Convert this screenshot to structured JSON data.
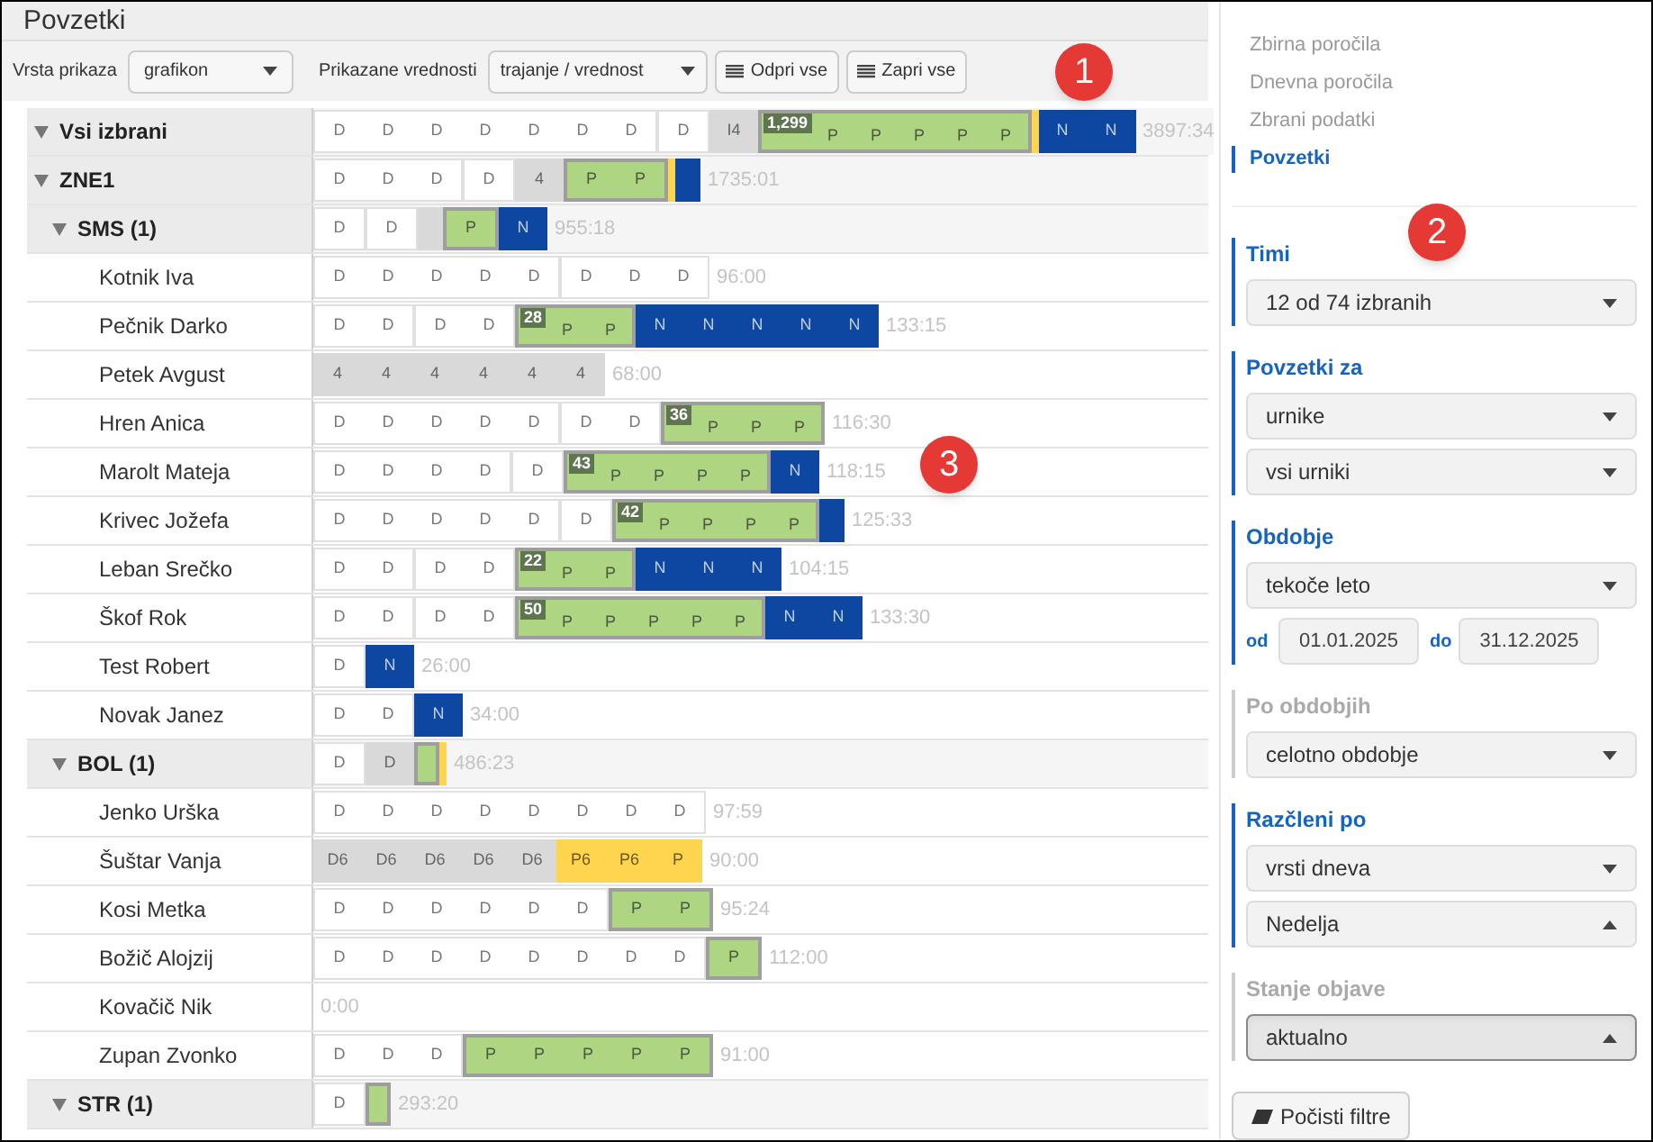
{
  "title": "Povzetki",
  "toolbar": {
    "display_type": {
      "label": "Vrsta prikaza",
      "value": "grafikon"
    },
    "shown_values": {
      "label": "Prikazane vrednosti",
      "value": "trajanje / vrednost"
    },
    "buttons": [
      "Odpri vse",
      "Zapri vse"
    ]
  },
  "tree": [
    {
      "label": "Vsi izbrani",
      "kind": "group",
      "expanded": true,
      "total": "3897:34",
      "blocks": [
        {
          "kind": "white",
          "cells": [
            "D",
            "D",
            "D",
            "D",
            "D",
            "D",
            "D"
          ]
        },
        {
          "kind": "white",
          "cells": [
            "D"
          ]
        },
        {
          "kind": "gray",
          "cells": [
            "I4"
          ]
        },
        {
          "kind": "green",
          "badge": "1,299",
          "cells": [
            "P",
            "P",
            "P",
            "P",
            "P"
          ]
        },
        {
          "kind": "stripe"
        },
        {
          "kind": "blue",
          "cells": [
            "N",
            "N"
          ]
        }
      ],
      "children": [
        {
          "label": "ZNE1",
          "kind": "group",
          "expanded": true,
          "total": "1735:01",
          "blocks": [
            {
              "kind": "white",
              "cells": [
                "D",
                "D",
                "D"
              ]
            },
            {
              "kind": "white",
              "cells": [
                "D"
              ]
            },
            {
              "kind": "gray",
              "cells": [
                "4"
              ]
            },
            {
              "kind": "green",
              "cells": [
                "P",
                "P"
              ]
            },
            {
              "kind": "stripe"
            },
            {
              "kind": "blue"
            }
          ],
          "children": [
            {
              "label": "SMS (1)",
              "kind": "subgroup",
              "expanded": true,
              "total": "955:18",
              "blocks": [
                {
                  "kind": "white",
                  "cells": [
                    "D"
                  ]
                },
                {
                  "kind": "white",
                  "cells": [
                    "D"
                  ]
                },
                {
                  "kind": "gray"
                },
                {
                  "kind": "green",
                  "cells": [
                    "P"
                  ]
                },
                {
                  "kind": "blue",
                  "cells": [
                    "N"
                  ]
                }
              ],
              "children": [
                {
                  "label": "Kotnik Iva",
                  "kind": "person",
                  "total": "96:00",
                  "blocks": [
                    {
                      "kind": "white",
                      "cells": [
                        "D",
                        "D",
                        "D",
                        "D",
                        "D"
                      ]
                    },
                    {
                      "kind": "white",
                      "cells": [
                        "D",
                        "D",
                        "D"
                      ]
                    }
                  ]
                },
                {
                  "label": "Pečnik Darko",
                  "kind": "person",
                  "total": "133:15",
                  "blocks": [
                    {
                      "kind": "white",
                      "cells": [
                        "D",
                        "D"
                      ]
                    },
                    {
                      "kind": "white",
                      "cells": [
                        "D",
                        "D"
                      ]
                    },
                    {
                      "kind": "green",
                      "badge": "28",
                      "cells": [
                        "P",
                        "P"
                      ]
                    },
                    {
                      "kind": "blue",
                      "cells": [
                        "N",
                        "N",
                        "N",
                        "N",
                        "N"
                      ]
                    }
                  ]
                },
                {
                  "label": "Petek Avgust",
                  "kind": "person",
                  "total": "68:00",
                  "blocks": [
                    {
                      "kind": "gray",
                      "cells": [
                        "4",
                        "4",
                        "4",
                        "4",
                        "4",
                        "4"
                      ]
                    }
                  ]
                },
                {
                  "label": "Hren Anica",
                  "kind": "person",
                  "total": "116:30",
                  "blocks": [
                    {
                      "kind": "white",
                      "cells": [
                        "D",
                        "D",
                        "D",
                        "D",
                        "D"
                      ]
                    },
                    {
                      "kind": "white",
                      "cells": [
                        "D",
                        "D"
                      ]
                    },
                    {
                      "kind": "green",
                      "badge": "36",
                      "cells": [
                        "P",
                        "P",
                        "P"
                      ]
                    }
                  ]
                },
                {
                  "label": "Marolt Mateja",
                  "kind": "person",
                  "total": "118:15",
                  "blocks": [
                    {
                      "kind": "white",
                      "cells": [
                        "D",
                        "D",
                        "D",
                        "D"
                      ]
                    },
                    {
                      "kind": "white",
                      "cells": [
                        "D"
                      ]
                    },
                    {
                      "kind": "green",
                      "badge": "43",
                      "cells": [
                        "P",
                        "P",
                        "P",
                        "P"
                      ]
                    },
                    {
                      "kind": "blue",
                      "cells": [
                        "N"
                      ]
                    }
                  ]
                },
                {
                  "label": "Krivec Jožefa",
                  "kind": "person",
                  "total": "125:33",
                  "blocks": [
                    {
                      "kind": "white",
                      "cells": [
                        "D",
                        "D",
                        "D",
                        "D",
                        "D"
                      ]
                    },
                    {
                      "kind": "white",
                      "cells": [
                        "D"
                      ]
                    },
                    {
                      "kind": "green",
                      "badge": "42",
                      "cells": [
                        "P",
                        "P",
                        "P",
                        "P"
                      ]
                    },
                    {
                      "kind": "blue"
                    }
                  ]
                },
                {
                  "label": "Leban Srečko",
                  "kind": "person",
                  "total": "104:15",
                  "blocks": [
                    {
                      "kind": "white",
                      "cells": [
                        "D",
                        "D"
                      ]
                    },
                    {
                      "kind": "white",
                      "cells": [
                        "D",
                        "D"
                      ]
                    },
                    {
                      "kind": "green",
                      "badge": "22",
                      "cells": [
                        "P",
                        "P"
                      ]
                    },
                    {
                      "kind": "blue",
                      "cells": [
                        "N",
                        "N",
                        "N"
                      ]
                    }
                  ]
                },
                {
                  "label": "Škof Rok",
                  "kind": "person",
                  "total": "133:30",
                  "blocks": [
                    {
                      "kind": "white",
                      "cells": [
                        "D",
                        "D"
                      ]
                    },
                    {
                      "kind": "white",
                      "cells": [
                        "D",
                        "D"
                      ]
                    },
                    {
                      "kind": "green",
                      "badge": "50",
                      "cells": [
                        "P",
                        "P",
                        "P",
                        "P",
                        "P"
                      ]
                    },
                    {
                      "kind": "blue",
                      "cells": [
                        "N",
                        "N"
                      ]
                    }
                  ]
                },
                {
                  "label": "Test Robert",
                  "kind": "person",
                  "total": "26:00",
                  "blocks": [
                    {
                      "kind": "white",
                      "cells": [
                        "D"
                      ]
                    },
                    {
                      "kind": "blue",
                      "cells": [
                        "N"
                      ]
                    }
                  ]
                },
                {
                  "label": "Novak Janez",
                  "kind": "person",
                  "total": "34:00",
                  "blocks": [
                    {
                      "kind": "white",
                      "cells": [
                        "D",
                        "D"
                      ]
                    },
                    {
                      "kind": "blue",
                      "cells": [
                        "N"
                      ]
                    }
                  ]
                }
              ]
            },
            {
              "label": "BOL (1)",
              "kind": "subgroup",
              "expanded": true,
              "total": "486:23",
              "blocks": [
                {
                  "kind": "white",
                  "cells": [
                    "D"
                  ]
                },
                {
                  "kind": "gray",
                  "cells": [
                    "D"
                  ]
                },
                {
                  "kind": "green"
                },
                {
                  "kind": "stripe"
                }
              ],
              "children": [
                {
                  "label": "Jenko Urška",
                  "kind": "person",
                  "total": "97:59",
                  "blocks": [
                    {
                      "kind": "white",
                      "cells": [
                        "D",
                        "D",
                        "D",
                        "D",
                        "D",
                        "D",
                        "D",
                        "D"
                      ]
                    }
                  ]
                },
                {
                  "label": "Šuštar Vanja",
                  "kind": "person",
                  "total": "90:00",
                  "blocks": [
                    {
                      "kind": "gray",
                      "cells": [
                        "D6",
                        "D6",
                        "D6",
                        "D6",
                        "D6"
                      ]
                    },
                    {
                      "kind": "yellow",
                      "cells": [
                        "P6",
                        "P6",
                        "P"
                      ]
                    }
                  ]
                },
                {
                  "label": "Kosi Metka",
                  "kind": "person",
                  "total": "95:24",
                  "blocks": [
                    {
                      "kind": "white",
                      "cells": [
                        "D",
                        "D",
                        "D",
                        "D",
                        "D",
                        "D"
                      ]
                    },
                    {
                      "kind": "green",
                      "cells": [
                        "P",
                        "P"
                      ]
                    }
                  ]
                },
                {
                  "label": "Božič Alojzij",
                  "kind": "person",
                  "total": "112:00",
                  "blocks": [
                    {
                      "kind": "white",
                      "cells": [
                        "D",
                        "D",
                        "D",
                        "D",
                        "D",
                        "D",
                        "D",
                        "D"
                      ]
                    },
                    {
                      "kind": "green",
                      "cells": [
                        "P"
                      ]
                    }
                  ]
                },
                {
                  "label": "Kovačič Nik",
                  "kind": "person",
                  "total": "0:00"
                },
                {
                  "label": "Zupan Zvonko",
                  "kind": "person",
                  "total": "91:00",
                  "blocks": [
                    {
                      "kind": "white",
                      "cells": [
                        "D",
                        "D",
                        "D"
                      ]
                    },
                    {
                      "kind": "green",
                      "cells": [
                        "P",
                        "P",
                        "P",
                        "P",
                        "P"
                      ]
                    }
                  ]
                }
              ]
            },
            {
              "label": "STR (1)",
              "kind": "subgroup",
              "expanded": true,
              "total": "293:20",
              "blocks": [
                {
                  "kind": "white",
                  "cells": [
                    "D"
                  ]
                },
                {
                  "kind": "green"
                }
              ]
            }
          ]
        }
      ]
    }
  ],
  "nav": [
    {
      "label": "Zbirna poročila",
      "selected": false
    },
    {
      "label": "Dnevna poročila",
      "selected": false
    },
    {
      "label": "Zbrani podatki",
      "selected": false
    },
    {
      "label": "Povzetki",
      "selected": true
    }
  ],
  "filters": [
    {
      "label": "Timi",
      "active": true,
      "fields": [
        {
          "kind": "select",
          "value": "12 od 74 izbranih",
          "expanded": false
        }
      ]
    },
    {
      "label": "Povzetki za",
      "active": true,
      "fields": [
        {
          "kind": "select",
          "value": "urnike",
          "expanded": false
        },
        {
          "kind": "select",
          "value": "vsi urniki",
          "expanded": false
        }
      ]
    },
    {
      "label": "Obdobje",
      "active": true,
      "fields": [
        {
          "kind": "select",
          "value": "tekoče leto",
          "expanded": false
        },
        {
          "kind": "dates",
          "from_label": "od",
          "from": "01.01.2025",
          "to_label": "do",
          "to": "31.12.2025"
        }
      ]
    },
    {
      "label": "Po obdobjih",
      "active": false,
      "fields": [
        {
          "kind": "select",
          "value": "celotno obdobje",
          "expanded": false
        }
      ]
    },
    {
      "label": "Razčleni po",
      "active": true,
      "fields": [
        {
          "kind": "select",
          "value": "vrsti dneva",
          "expanded": false
        },
        {
          "kind": "select",
          "value": "Nedelja",
          "expanded": true
        }
      ]
    },
    {
      "label": "Stanje objave",
      "active": false,
      "fields": [
        {
          "kind": "select",
          "value": "aktualno",
          "expanded": true,
          "focused": true
        }
      ]
    }
  ],
  "clear_button": "Počisti filtre",
  "callouts": [
    "1",
    "2",
    "3"
  ]
}
